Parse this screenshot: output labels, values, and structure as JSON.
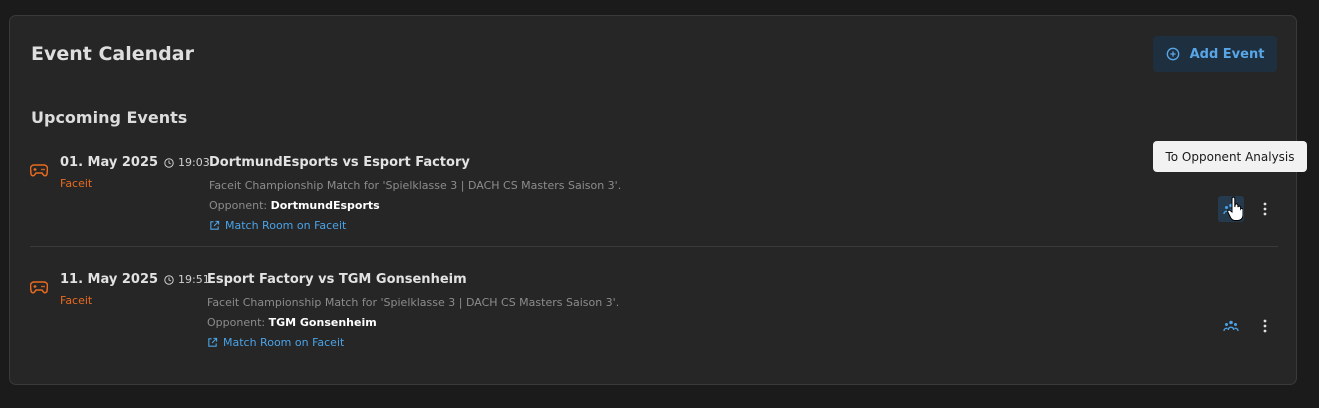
{
  "header": {
    "title": "Event Calendar",
    "add_event_label": "Add Event"
  },
  "section": {
    "title": "Upcoming Events"
  },
  "events": [
    {
      "date": "01. May 2025",
      "time": "19:03",
      "platform": "Faceit",
      "title": "DortmundEsports vs Esport Factory",
      "description": "Faceit Championship Match for 'Spielklasse 3 | DACH CS Masters Saison 3'.",
      "opponent_label": "Opponent:",
      "opponent": "DortmundEsports",
      "link_label": "Match Room on Faceit"
    },
    {
      "date": "11. May 2025",
      "time": "19:51",
      "platform": "Faceit",
      "title": "Esport Factory vs TGM Gonsenheim",
      "description": "Faceit Championship Match for 'Spielklasse 3 | DACH CS Masters Saison 3'.",
      "opponent_label": "Opponent:",
      "opponent": "TGM Gonsenheim",
      "link_label": "Match Room on Faceit"
    }
  ],
  "tooltip": {
    "text": "To Opponent Analysis"
  },
  "icons": {
    "game": "gamepad-icon",
    "clock": "clock-icon",
    "external": "external-link-icon",
    "team": "team-icon",
    "more": "kebab-menu-icon",
    "add": "plus-circle-icon"
  },
  "colors": {
    "accent": "#4aa3e8",
    "platform": "#e86a1f",
    "background": "#1b1b1b",
    "panel": "#262626"
  }
}
